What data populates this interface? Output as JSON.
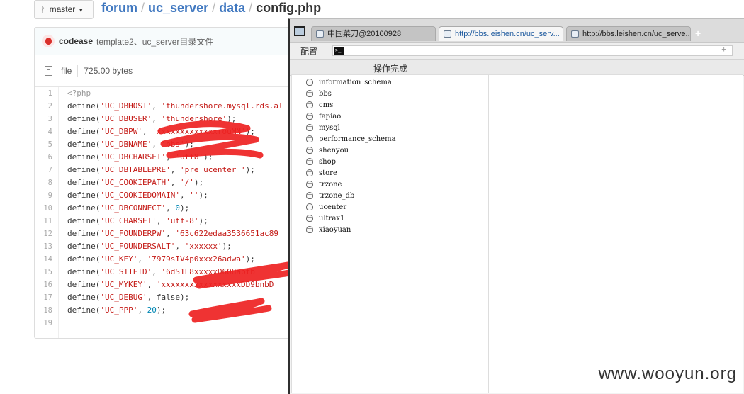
{
  "repo": {
    "branch": "master",
    "crumbs": [
      "forum",
      "uc_server",
      "data"
    ],
    "file_name": "config.php",
    "separator": "/"
  },
  "commit": {
    "author": "codease",
    "message": "template2、uc_server目录文件"
  },
  "file": {
    "type_label": "file",
    "size": "725.00 bytes"
  },
  "code": {
    "line_numbers": [
      "1",
      "2",
      "3",
      "4",
      "5",
      "6",
      "7",
      "8",
      "9",
      "10",
      "11",
      "12",
      "13",
      "14",
      "15",
      "16",
      "17",
      "18",
      "19"
    ],
    "lines": [
      "<?php",
      "define('UC_DBHOST', 'thundershore.mysql.rds.al",
      "define('UC_DBUSER', 'thundershore');",
      "define('UC_DBPW', 'xxxxxxxxxxxxxrouMN');",
      "define('UC_DBNAME', 'bbs');",
      "define('UC_DBCHARSET', 'utf8');",
      "define('UC_DBTABLEPRE', 'pre_ucenter_');",
      "define('UC_COOKIEPATH', '/');",
      "define('UC_COOKIEDOMAIN', '');",
      "define('UC_DBCONNECT', 0);",
      "define('UC_CHARSET', 'utf-8');",
      "define('UC_FOUNDERPW', '63c622edaa3536651ac89",
      "define('UC_FOUNDERSALT', 'xxxxxx');",
      "define('UC_KEY', '7979sIV4p0xxx26adwa');",
      "define('UC_SITEID', '6dS1L8xxxxxD6O8abtb",
      "define('UC_MYKEY', 'xxxxxxxxxxxxxxxxxDD9bnbD",
      "define('UC_DEBUG', false);",
      "define('UC_PPP', 20);",
      ""
    ]
  },
  "browser": {
    "tabs": [
      {
        "label": "中国菜刀@20100928"
      },
      {
        "label": "http://bbs.leishen.cn/uc_serv..."
      },
      {
        "label": "http://bbs.leishen.cn/uc_serve..."
      }
    ],
    "new_tab": "+",
    "config_label": "配置",
    "url_prompt": ">_",
    "bookmark": "±",
    "status": "操作完成",
    "databases": [
      "information_schema",
      "bbs",
      "cms",
      "fapiao",
      "mysql",
      "performance_schema",
      "shenyou",
      "shop",
      "store",
      "trzone",
      "trzone_db",
      "ucenter",
      "ultrax1",
      "xiaoyuan"
    ]
  },
  "watermark": "www.wooyun.org"
}
